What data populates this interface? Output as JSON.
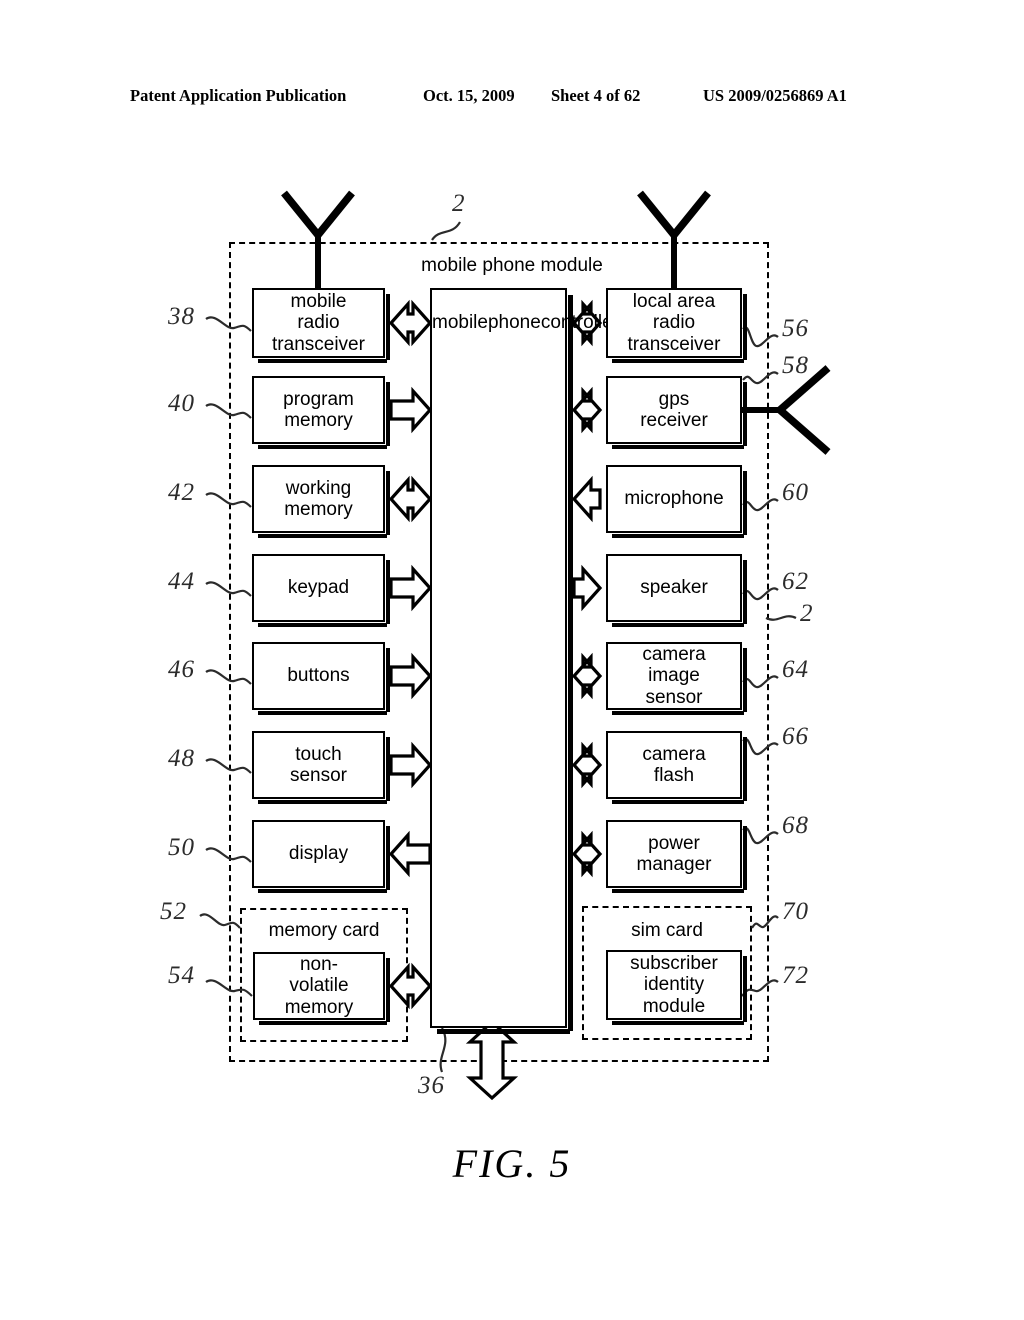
{
  "header": {
    "publication": "Patent Application Publication",
    "date": "Oct. 15, 2009",
    "sheet": "Sheet 4 of 62",
    "number": "US 2009/0256869 A1"
  },
  "figure": {
    "caption": "FIG. 5",
    "module_title": "mobile phone module",
    "controller_label": "mobile\nphone\ncontroller",
    "memory_card_title": "memory card",
    "sim_card_title": "sim card"
  },
  "blocks": {
    "left": [
      {
        "label": "mobile\nradio\ntransceiver",
        "ref": "38",
        "arrow": "both",
        "antenna": true
      },
      {
        "label": "program\nmemory",
        "ref": "40",
        "arrow": "right",
        "antenna": false
      },
      {
        "label": "working\nmemory",
        "ref": "42",
        "arrow": "both",
        "antenna": false
      },
      {
        "label": "keypad",
        "ref": "44",
        "arrow": "right",
        "antenna": false
      },
      {
        "label": "buttons",
        "ref": "46",
        "arrow": "right",
        "antenna": false
      },
      {
        "label": "touch\nsensor",
        "ref": "48",
        "arrow": "right",
        "antenna": false
      },
      {
        "label": "display",
        "ref": "50",
        "arrow": "left",
        "antenna": false
      }
    ],
    "right": [
      {
        "label": "local area\nradio\ntransceiver",
        "ref": "56",
        "arrow": "both",
        "antenna": true
      },
      {
        "label": "gps\nreceiver",
        "ref": "58",
        "arrow": "both",
        "antenna": true
      },
      {
        "label": "microphone",
        "ref": "60",
        "arrow": "left",
        "antenna": false
      },
      {
        "label": "speaker",
        "ref": "62",
        "arrow": "right",
        "antenna": false
      },
      {
        "label": "camera\nimage\nsensor",
        "ref": "64",
        "arrow": "both",
        "antenna": false
      },
      {
        "label": "camera\nflash",
        "ref": "66",
        "arrow": "both",
        "antenna": false
      },
      {
        "label": "power\nmanager",
        "ref": "68",
        "arrow": "both",
        "antenna": false
      }
    ],
    "memory_card": {
      "label": "non-\nvolatile\nmemory",
      "ref": "54",
      "card_ref": "52",
      "arrow": "both"
    },
    "sim_card": {
      "label": "subscriber\nidentity\nmodule",
      "ref": "72",
      "card_ref": "70",
      "arrow": "none"
    }
  },
  "refs": {
    "module_top": "2",
    "module_side": "2",
    "bottom_bus": "36"
  },
  "colors": {
    "ink": "#000000",
    "paper": "#ffffff",
    "ref_ink": "#2b2b2b"
  }
}
